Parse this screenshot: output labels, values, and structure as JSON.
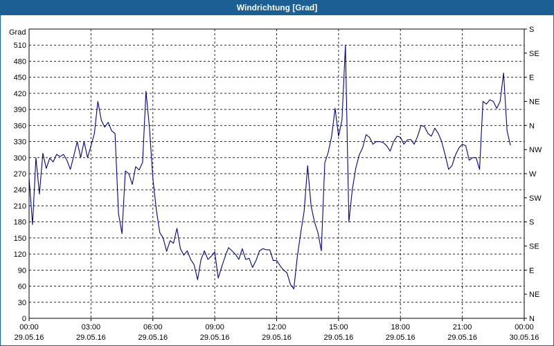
{
  "window": {
    "title": "Windrichtung [Grad]"
  },
  "chart_data": {
    "type": "line",
    "title": "Windrichtung [Grad]",
    "ylabel": "Grad",
    "ylim": [
      0,
      540
    ],
    "yticks": [
      0,
      30,
      60,
      90,
      120,
      150,
      180,
      210,
      240,
      270,
      300,
      330,
      360,
      390,
      420,
      450,
      480,
      510
    ],
    "right_ticks": [
      {
        "value": 0,
        "label": "N"
      },
      {
        "value": 45,
        "label": "NE"
      },
      {
        "value": 90,
        "label": "E"
      },
      {
        "value": 135,
        "label": "SE"
      },
      {
        "value": 180,
        "label": "S"
      },
      {
        "value": 225,
        "label": "SW"
      },
      {
        "value": 270,
        "label": "W"
      },
      {
        "value": 315,
        "label": "NW"
      },
      {
        "value": 360,
        "label": "N"
      },
      {
        "value": 405,
        "label": "NE"
      },
      {
        "value": 450,
        "label": "E"
      },
      {
        "value": 495,
        "label": "SE"
      },
      {
        "value": 540,
        "label": "S"
      }
    ],
    "xlim": [
      "29.05.16 00:00",
      "30.05.16 00:00"
    ],
    "xticks": [
      {
        "time": "00:00",
        "date": "29.05.16"
      },
      {
        "time": "03:00",
        "date": "29.05.16"
      },
      {
        "time": "06:00",
        "date": "29.05.16"
      },
      {
        "time": "09:00",
        "date": "29.05.16"
      },
      {
        "time": "12:00",
        "date": "29.05.16"
      },
      {
        "time": "15:00",
        "date": "29.05.16"
      },
      {
        "time": "18:00",
        "date": "29.05.16"
      },
      {
        "time": "21:00",
        "date": "29.05.16"
      },
      {
        "time": "00:00",
        "date": "30.05.16"
      }
    ],
    "grid": true,
    "series": [
      {
        "color": "#00008b",
        "points": [
          {
            "t": "00:00",
            "v": 262
          },
          {
            "t": "00:10",
            "v": 175
          },
          {
            "t": "00:20",
            "v": 300
          },
          {
            "t": "00:30",
            "v": 232
          },
          {
            "t": "00:40",
            "v": 308
          },
          {
            "t": "00:50",
            "v": 280
          },
          {
            "t": "01:00",
            "v": 299
          },
          {
            "t": "01:10",
            "v": 292
          },
          {
            "t": "01:20",
            "v": 306
          },
          {
            "t": "01:30",
            "v": 302
          },
          {
            "t": "01:40",
            "v": 306
          },
          {
            "t": "01:50",
            "v": 295
          },
          {
            "t": "02:00",
            "v": 278
          },
          {
            "t": "02:10",
            "v": 303
          },
          {
            "t": "02:20",
            "v": 330
          },
          {
            "t": "02:30",
            "v": 300
          },
          {
            "t": "02:40",
            "v": 330
          },
          {
            "t": "02:50",
            "v": 300
          },
          {
            "t": "03:00",
            "v": 322
          },
          {
            "t": "03:10",
            "v": 345
          },
          {
            "t": "03:20",
            "v": 405
          },
          {
            "t": "03:30",
            "v": 370
          },
          {
            "t": "03:40",
            "v": 357
          },
          {
            "t": "03:50",
            "v": 366
          },
          {
            "t": "04:00",
            "v": 350
          },
          {
            "t": "04:10",
            "v": 345
          },
          {
            "t": "04:20",
            "v": 196
          },
          {
            "t": "04:30",
            "v": 158
          },
          {
            "t": "04:40",
            "v": 275
          },
          {
            "t": "04:50",
            "v": 270
          },
          {
            "t": "05:00",
            "v": 250
          },
          {
            "t": "05:10",
            "v": 283
          },
          {
            "t": "05:20",
            "v": 277
          },
          {
            "t": "05:30",
            "v": 291
          },
          {
            "t": "05:40",
            "v": 424
          },
          {
            "t": "05:50",
            "v": 356
          },
          {
            "t": "06:00",
            "v": 261
          },
          {
            "t": "06:10",
            "v": 203
          },
          {
            "t": "06:20",
            "v": 160
          },
          {
            "t": "06:30",
            "v": 150
          },
          {
            "t": "06:40",
            "v": 125
          },
          {
            "t": "06:50",
            "v": 145
          },
          {
            "t": "07:00",
            "v": 140
          },
          {
            "t": "07:10",
            "v": 168
          },
          {
            "t": "07:20",
            "v": 130
          },
          {
            "t": "07:30",
            "v": 118
          },
          {
            "t": "07:40",
            "v": 126
          },
          {
            "t": "07:50",
            "v": 110
          },
          {
            "t": "08:00",
            "v": 100
          },
          {
            "t": "08:10",
            "v": 72
          },
          {
            "t": "08:20",
            "v": 110
          },
          {
            "t": "08:30",
            "v": 126
          },
          {
            "t": "08:40",
            "v": 110
          },
          {
            "t": "08:50",
            "v": 116
          },
          {
            "t": "09:00",
            "v": 124
          },
          {
            "t": "09:10",
            "v": 75
          },
          {
            "t": "09:20",
            "v": 96
          },
          {
            "t": "09:30",
            "v": 115
          },
          {
            "t": "09:40",
            "v": 132
          },
          {
            "t": "09:50",
            "v": 126
          },
          {
            "t": "10:00",
            "v": 120
          },
          {
            "t": "10:10",
            "v": 110
          },
          {
            "t": "10:20",
            "v": 130
          },
          {
            "t": "10:30",
            "v": 110
          },
          {
            "t": "10:40",
            "v": 112
          },
          {
            "t": "10:50",
            "v": 95
          },
          {
            "t": "11:00",
            "v": 108
          },
          {
            "t": "11:10",
            "v": 126
          },
          {
            "t": "11:20",
            "v": 130
          },
          {
            "t": "11:30",
            "v": 128
          },
          {
            "t": "11:40",
            "v": 128
          },
          {
            "t": "11:50",
            "v": 108
          },
          {
            "t": "12:00",
            "v": 108
          },
          {
            "t": "12:10",
            "v": 98
          },
          {
            "t": "12:20",
            "v": 90
          },
          {
            "t": "12:30",
            "v": 85
          },
          {
            "t": "12:40",
            "v": 63
          },
          {
            "t": "12:50",
            "v": 55
          },
          {
            "t": "13:00",
            "v": 115
          },
          {
            "t": "13:10",
            "v": 160
          },
          {
            "t": "13:20",
            "v": 200
          },
          {
            "t": "13:30",
            "v": 285
          },
          {
            "t": "13:40",
            "v": 210
          },
          {
            "t": "13:50",
            "v": 180
          },
          {
            "t": "14:00",
            "v": 160
          },
          {
            "t": "14:10",
            "v": 126
          },
          {
            "t": "14:20",
            "v": 290
          },
          {
            "t": "14:30",
            "v": 310
          },
          {
            "t": "14:40",
            "v": 340
          },
          {
            "t": "14:50",
            "v": 392
          },
          {
            "t": "15:00",
            "v": 340
          },
          {
            "t": "15:10",
            "v": 370
          },
          {
            "t": "15:20",
            "v": 510
          },
          {
            "t": "15:30",
            "v": 180
          },
          {
            "t": "15:40",
            "v": 240
          },
          {
            "t": "15:50",
            "v": 280
          },
          {
            "t": "16:00",
            "v": 305
          },
          {
            "t": "16:10",
            "v": 318
          },
          {
            "t": "16:20",
            "v": 343
          },
          {
            "t": "16:30",
            "v": 338
          },
          {
            "t": "16:40",
            "v": 325
          },
          {
            "t": "16:50",
            "v": 330
          },
          {
            "t": "17:00",
            "v": 330
          },
          {
            "t": "17:10",
            "v": 328
          },
          {
            "t": "17:20",
            "v": 322
          },
          {
            "t": "17:30",
            "v": 312
          },
          {
            "t": "17:40",
            "v": 330
          },
          {
            "t": "17:50",
            "v": 340
          },
          {
            "t": "18:00",
            "v": 338
          },
          {
            "t": "18:10",
            "v": 325
          },
          {
            "t": "18:20",
            "v": 333
          },
          {
            "t": "18:30",
            "v": 334
          },
          {
            "t": "18:40",
            "v": 325
          },
          {
            "t": "18:50",
            "v": 340
          },
          {
            "t": "19:00",
            "v": 360
          },
          {
            "t": "19:10",
            "v": 358
          },
          {
            "t": "19:20",
            "v": 345
          },
          {
            "t": "19:30",
            "v": 340
          },
          {
            "t": "19:40",
            "v": 355
          },
          {
            "t": "19:50",
            "v": 345
          },
          {
            "t": "20:00",
            "v": 330
          },
          {
            "t": "20:10",
            "v": 305
          },
          {
            "t": "20:20",
            "v": 278
          },
          {
            "t": "20:30",
            "v": 285
          },
          {
            "t": "20:40",
            "v": 305
          },
          {
            "t": "20:50",
            "v": 318
          },
          {
            "t": "21:00",
            "v": 325
          },
          {
            "t": "21:10",
            "v": 322
          },
          {
            "t": "21:20",
            "v": 295
          },
          {
            "t": "21:30",
            "v": 300
          },
          {
            "t": "21:40",
            "v": 300
          },
          {
            "t": "21:50",
            "v": 278
          },
          {
            "t": "22:00",
            "v": 405
          },
          {
            "t": "22:10",
            "v": 400
          },
          {
            "t": "22:20",
            "v": 408
          },
          {
            "t": "22:30",
            "v": 405
          },
          {
            "t": "22:40",
            "v": 392
          },
          {
            "t": "22:50",
            "v": 405
          },
          {
            "t": "23:00",
            "v": 458
          },
          {
            "t": "23:10",
            "v": 350
          },
          {
            "t": "23:20",
            "v": 323
          }
        ]
      }
    ]
  }
}
